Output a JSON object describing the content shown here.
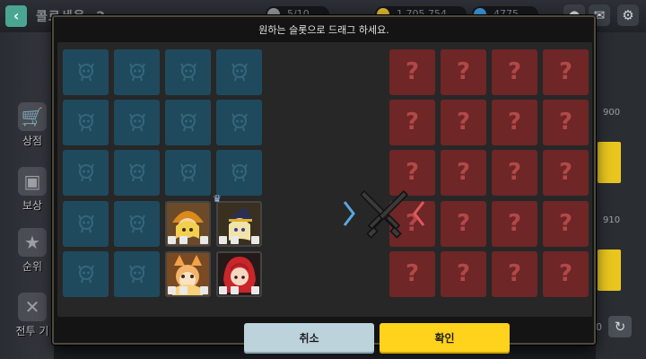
{
  "topbar": {
    "back_icon": "chevron-left-icon",
    "title": "콜로세움",
    "counter": "2",
    "resources": [
      {
        "value": "5/10",
        "coin_color": "#8d8f93"
      },
      {
        "value": "1,705,754",
        "coin_color": "#d9b12e"
      },
      {
        "value": "4775",
        "coin_color": "#3b8fd1"
      }
    ],
    "icons": [
      "chat-icon",
      "mail-icon",
      "settings-icon"
    ]
  },
  "sidebar": {
    "items": [
      {
        "label": "상점",
        "icon": "cart-icon"
      },
      {
        "label": "보상",
        "icon": "gift-icon"
      },
      {
        "label": "순위",
        "icon": "trophy-icon"
      },
      {
        "label": "전투 기",
        "icon": "battle-log-icon"
      }
    ]
  },
  "rightpanel": {
    "values": [
      "900",
      "910",
      "0"
    ],
    "icon": "refresh-icon"
  },
  "modal": {
    "title": "원하는 슬롯으로 드래그 하세요.",
    "cancel_label": "취소",
    "confirm_label": "확인",
    "enemy_slot_mark": "?",
    "ally_slot_icon": "empty-slot-icon",
    "versus_icon": "crossed-swords-icon",
    "ally_color": "#1f4a5e",
    "enemy_color": "#6e2626",
    "confirm_color": "#ffd21c",
    "cancel_color": "#bcd3dc"
  },
  "ally_grid": {
    "rows": 5,
    "cols": 4,
    "heroes": [
      {
        "name": "hero-orange-hat",
        "row": 4,
        "col": 3
      },
      {
        "name": "hero-witch",
        "row": 4,
        "col": 4,
        "leader": true
      },
      {
        "name": "hero-fox",
        "row": 5,
        "col": 3
      },
      {
        "name": "hero-red-hair",
        "row": 5,
        "col": 4
      }
    ]
  },
  "enemy_grid": {
    "rows": 5,
    "cols": 4
  }
}
